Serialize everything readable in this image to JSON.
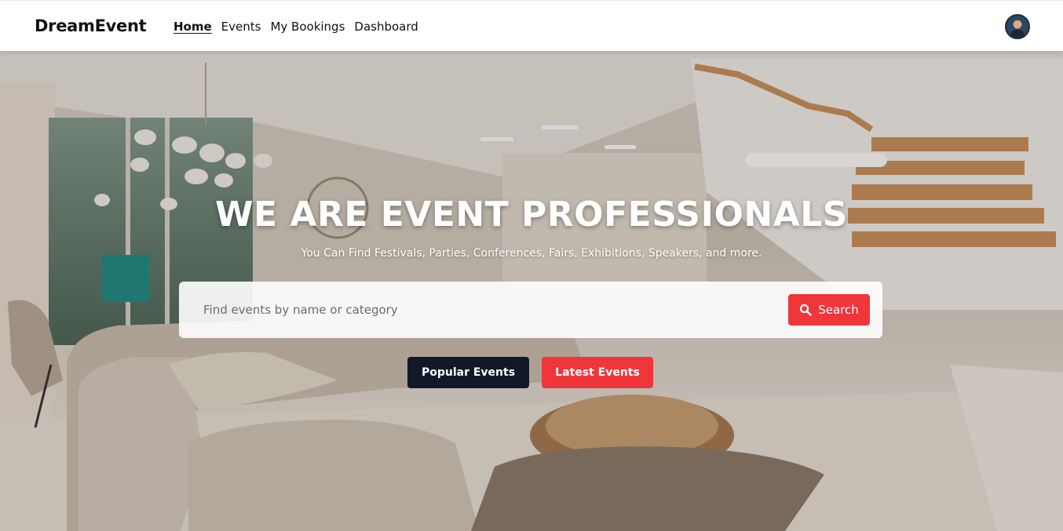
{
  "brand": {
    "name": "DreamEvent"
  },
  "nav": {
    "items": [
      {
        "label": "Home",
        "active": true
      },
      {
        "label": "Events",
        "active": false
      },
      {
        "label": "My Bookings",
        "active": false
      },
      {
        "label": "Dashboard",
        "active": false
      }
    ]
  },
  "hero": {
    "title": "WE ARE EVENT PROFESSIONALS",
    "subtitle": "You Can Find Festivals, Parties, Conferences, Fairs, Exhibitions, Speakers, and more."
  },
  "search": {
    "placeholder": "Find events by name or category",
    "value": "",
    "button_label": "Search",
    "button_icon": "search-icon"
  },
  "actions": {
    "popular_label": "Popular Events",
    "latest_label": "Latest Events"
  },
  "colors": {
    "accent": "#f0353b",
    "dark_button": "#111827",
    "text": "#111111"
  }
}
